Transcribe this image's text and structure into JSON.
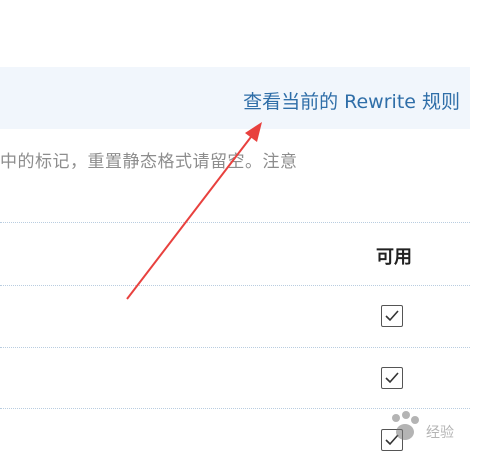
{
  "banner": {
    "link_text": "查看当前的 Rewrite 规则"
  },
  "hint": {
    "text": "中的标记，重置静态格式请留空。注意"
  },
  "table": {
    "enabled_header": "可用",
    "rows": [
      {
        "enabled": true
      },
      {
        "enabled": true
      },
      {
        "enabled": true
      }
    ]
  },
  "watermark": {
    "text": "经验"
  },
  "colors": {
    "link": "#2f6ea8",
    "banner_bg": "#f1f6fc",
    "arrow": "#e8413e"
  }
}
